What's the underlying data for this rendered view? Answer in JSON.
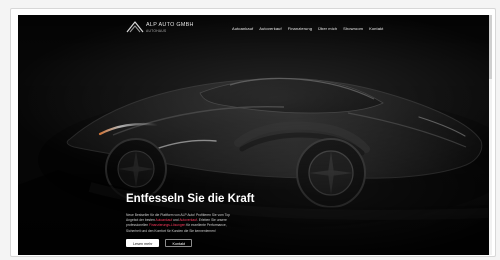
{
  "brand": {
    "name": "ALP AUTO GMBH",
    "tagline": "AUTOHAUS"
  },
  "nav": {
    "items": [
      {
        "label": "Autoankauf"
      },
      {
        "label": "Autoverkauf"
      },
      {
        "label": "Finanzierung"
      },
      {
        "label": "Über mich"
      },
      {
        "label": "Showroom"
      },
      {
        "label": "Kontakt"
      }
    ]
  },
  "hero": {
    "headline": "Entfesseln Sie die Kraft",
    "paragraph": {
      "line1": "Neue Bestseller für die Plattform von ALP Auto! Profitieren Sie vom Top",
      "line2_prefix": "Angebot der besten ",
      "line2_link1": "Autoankauf",
      "line2_mid": " und ",
      "line2_link2": "Autoverkauf",
      "line2_suffix": ". Erleben Sie unsere",
      "line3_prefix": "professionellen ",
      "line3_link": "Finanzierungs-Lösungen",
      "line3_suffix": " für exzellente Performance,",
      "line4": "Sicherheit und den Komfort für Kunden die Sie kennenlernen!"
    },
    "buttons": {
      "primary": "Lesen mehr",
      "secondary": "Kontakt"
    }
  },
  "colors": {
    "accent": "#ff3b5f",
    "hero_background": "#070707"
  }
}
